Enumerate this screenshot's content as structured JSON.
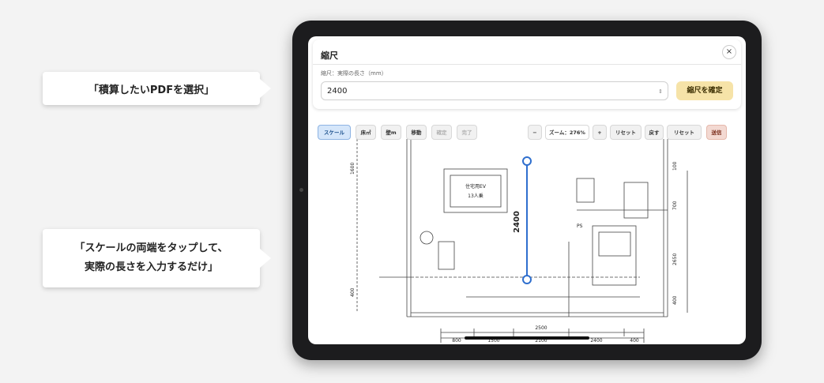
{
  "callouts": {
    "select_pdf": "「積算したいPDFを選択」",
    "scale_line1": "「スケールの両端をタップして、",
    "scale_line2": "実際の長さを入力するだけ」"
  },
  "dialog": {
    "title": "縮尺",
    "close_label": "×",
    "field_label": "縮尺：実際の長さ（mm）",
    "input_value": "2400",
    "confirm_label": "縮尺を確定"
  },
  "toolbar": {
    "scale": "スケール",
    "area": "床㎡",
    "wall": "壁m",
    "move": "移動",
    "confirm": "確定",
    "finish": "完了",
    "zoom_out": "−",
    "zoom_label": "ズーム：276%",
    "zoom_in": "+",
    "reset": "リセット",
    "undo": "戻す",
    "reset2": "リセット",
    "send": "送信"
  },
  "plan": {
    "elevator_line1": "住宅用EV",
    "elevator_line2": "13人乗",
    "measure_label": "2400",
    "ps_label": "PS",
    "dims_bottom": [
      "800",
      "1500",
      "2100",
      "2400",
      "400"
    ],
    "dim_total": "2500",
    "dims_right": [
      "100",
      "700",
      "2650",
      "400"
    ],
    "dim_left_top": "1600",
    "dim_left_bottom": "400"
  },
  "colors": {
    "measure": "#2f6fce",
    "confirm_bg": "#f6e3a8",
    "active_bg": "#d5e6fa"
  }
}
